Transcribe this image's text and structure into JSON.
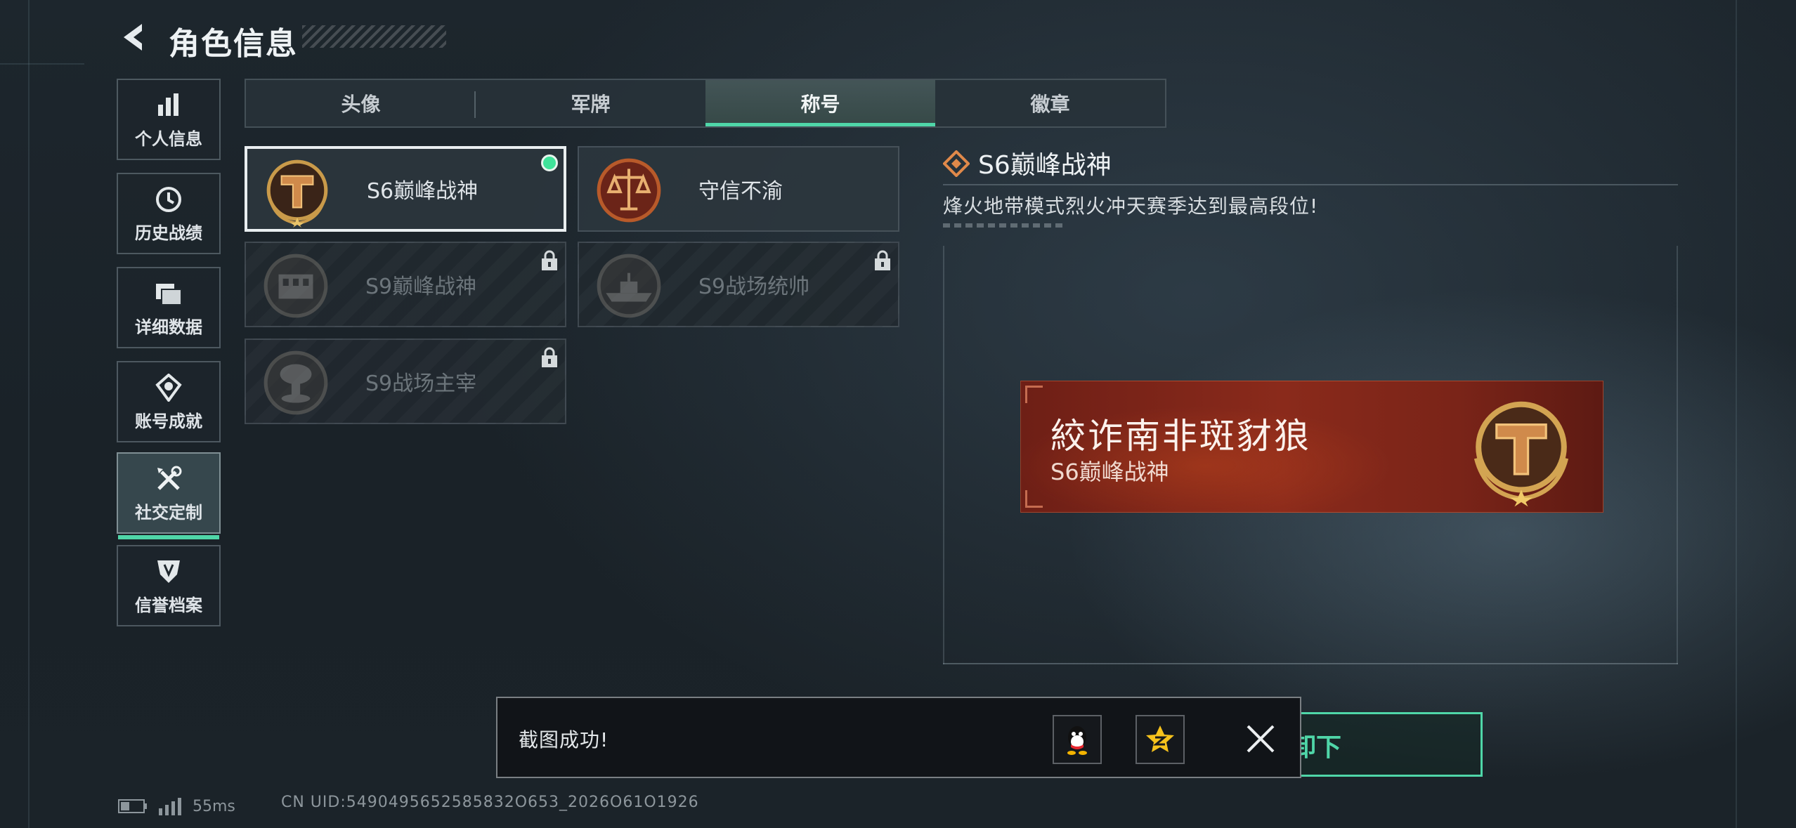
{
  "header": {
    "title": "角色信息"
  },
  "sidebar": {
    "items": [
      {
        "label": "个人信息",
        "icon": "bar-chart-icon"
      },
      {
        "label": "历史战绩",
        "icon": "clock-icon"
      },
      {
        "label": "详细数据",
        "icon": "folder-icon"
      },
      {
        "label": "账号成就",
        "icon": "medal-icon"
      },
      {
        "label": "社交定制",
        "icon": "tools-icon",
        "active": true
      },
      {
        "label": "信誉档案",
        "icon": "shield-icon"
      }
    ]
  },
  "tabs": [
    {
      "label": "头像"
    },
    {
      "label": "军牌"
    },
    {
      "label": "称号",
      "active": true
    },
    {
      "label": "徽章"
    }
  ],
  "titles": [
    {
      "name": "S6巅峰战神",
      "locked": false,
      "selected": true,
      "equipped": true
    },
    {
      "name": "守信不渝",
      "locked": false
    },
    {
      "name": "S9巅峰战神",
      "locked": true
    },
    {
      "name": "S9战场统帅",
      "locked": true
    },
    {
      "name": "S9战场主宰",
      "locked": true
    }
  ],
  "detail": {
    "name": "S6巅峰战神",
    "description": "烽火地带模式烈火冲天赛季达到最高段位!"
  },
  "nameplate": {
    "player_name": "絞诈南非斑豺狼",
    "title": "S6巅峰战神"
  },
  "unequip_button": {
    "label": "卸下"
  },
  "toast": {
    "message": "截图成功!",
    "share_targets": [
      "qq-icon",
      "qzone-icon"
    ]
  },
  "status_bar": {
    "ping": "55ms",
    "uid": "CN UID:5490495652585832O653_2026O61O1926"
  },
  "colors": {
    "accent": "#4fd6a8",
    "equipped_dot": "#3fe39a",
    "nameplate": "#7a2418",
    "badge_gold": "#c99a4a"
  }
}
